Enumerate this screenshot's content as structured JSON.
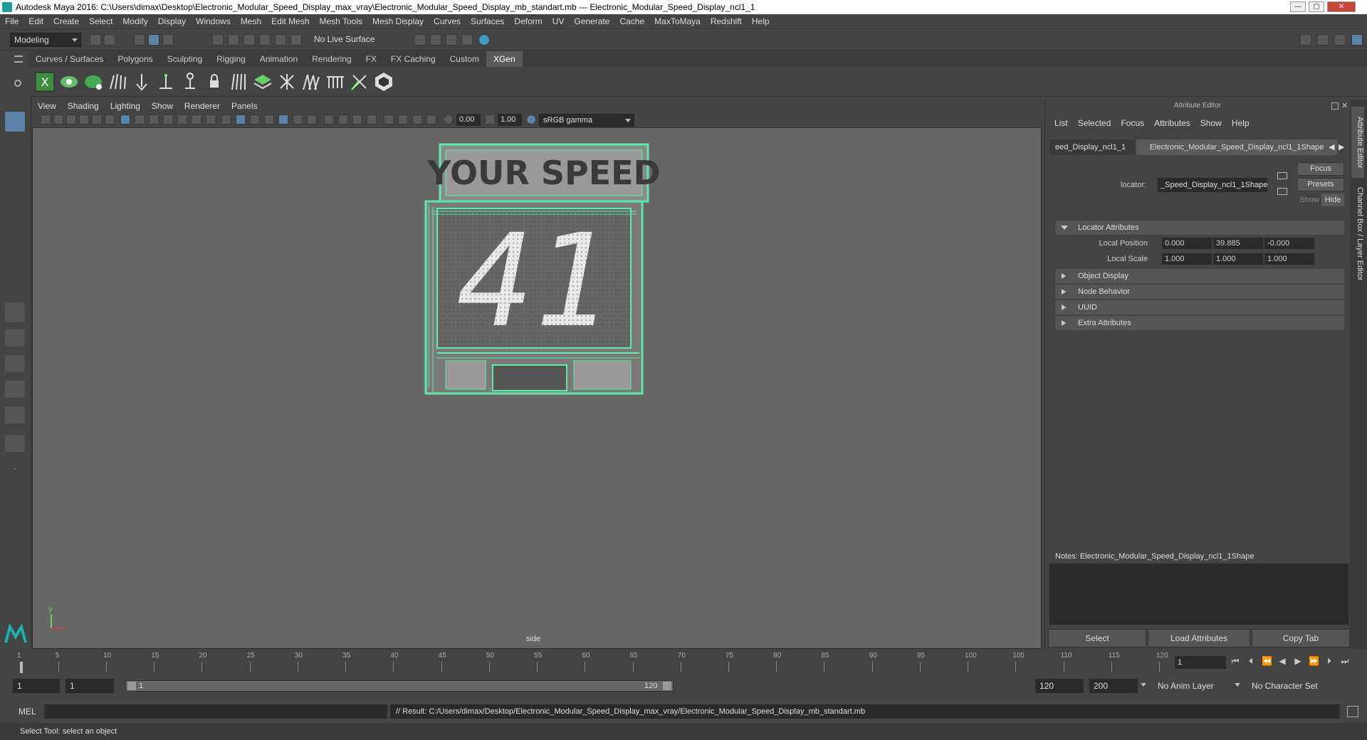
{
  "window": {
    "title": "Autodesk Maya 2016: C:\\Users\\dimax\\Desktop\\Electronic_Modular_Speed_Display_max_vray\\Electronic_Modular_Speed_Display_mb_standart.mb   ---   Electronic_Modular_Speed_Display_ncl1_1",
    "minimize": "—",
    "maximize": "▢",
    "close": "✕"
  },
  "menubar": [
    "File",
    "Edit",
    "Create",
    "Select",
    "Modify",
    "Display",
    "Windows",
    "Mesh",
    "Edit Mesh",
    "Mesh Tools",
    "Mesh Display",
    "Curves",
    "Surfaces",
    "Deform",
    "UV",
    "Generate",
    "Cache",
    "MaxToMaya",
    "Redshift",
    "Help"
  ],
  "statusline": {
    "mode": "Modeling",
    "live_surface": "No Live Surface"
  },
  "shelf_tabs": [
    "Curves / Surfaces",
    "Polygons",
    "Sculpting",
    "Rigging",
    "Animation",
    "Rendering",
    "FX",
    "FX Caching",
    "Custom",
    "XGen"
  ],
  "shelf_active": "XGen",
  "viewport": {
    "menu": [
      "View",
      "Shading",
      "Lighting",
      "Show",
      "Renderer",
      "Panels"
    ],
    "exposure": "0.00",
    "gamma": "1.00",
    "colorspace": "sRGB gamma",
    "camera": "side",
    "sign_top_text": "YOUR SPEED",
    "sign_number": "41",
    "axis_y": "y",
    "axis_z": "z"
  },
  "attribute_editor": {
    "header": "Attribute Editor",
    "menu": [
      "List",
      "Selected",
      "Focus",
      "Attributes",
      "Show",
      "Help"
    ],
    "tab_left": "eed_Display_ncl1_1",
    "tab_active": "Electronic_Modular_Speed_Display_ncl1_1Shape",
    "locator_label": "locator:",
    "locator_value": "_Speed_Display_ncl1_1Shape",
    "btn_focus": "Focus",
    "btn_presets": "Presets",
    "btn_show": "Show",
    "btn_hide": "Hide",
    "section_locator": "Locator Attributes",
    "local_position_label": "Local Position",
    "local_position": [
      "0.000",
      "39.885",
      "-0.000"
    ],
    "local_scale_label": "Local Scale",
    "local_scale": [
      "1.000",
      "1.000",
      "1.000"
    ],
    "sections": [
      "Object Display",
      "Node Behavior",
      "UUID",
      "Extra Attributes"
    ],
    "notes_label": "Notes:  Electronic_Modular_Speed_Display_ncl1_1Shape",
    "btn_select": "Select",
    "btn_load": "Load Attributes",
    "btn_copy": "Copy Tab"
  },
  "side_tabs": [
    "Attribute Editor",
    "Channel Box / Layer Editor"
  ],
  "timeline": {
    "ticks": [
      "1",
      "5",
      "10",
      "15",
      "20",
      "25",
      "30",
      "35",
      "40",
      "45",
      "50",
      "55",
      "60",
      "65",
      "70",
      "75",
      "80",
      "85",
      "90",
      "95",
      "100",
      "105",
      "110",
      "115",
      "120"
    ],
    "current_frame": "1"
  },
  "range": {
    "start": "1",
    "start2": "1",
    "slider_start": "1",
    "slider_end": "120",
    "end": "120",
    "end2": "200",
    "anim_layer": "No Anim Layer",
    "char_set": "No Character Set"
  },
  "cmdline": {
    "label": "MEL",
    "result": "// Result: C:/Users/dimax/Desktop/Electronic_Modular_Speed_Display_max_vray/Electronic_Modular_Speed_Display_mb_standart.mb"
  },
  "helpline": "Select Tool: select an object",
  "colors": {
    "wireframe": "#5fe8a8",
    "accent": "#5b82a8"
  }
}
